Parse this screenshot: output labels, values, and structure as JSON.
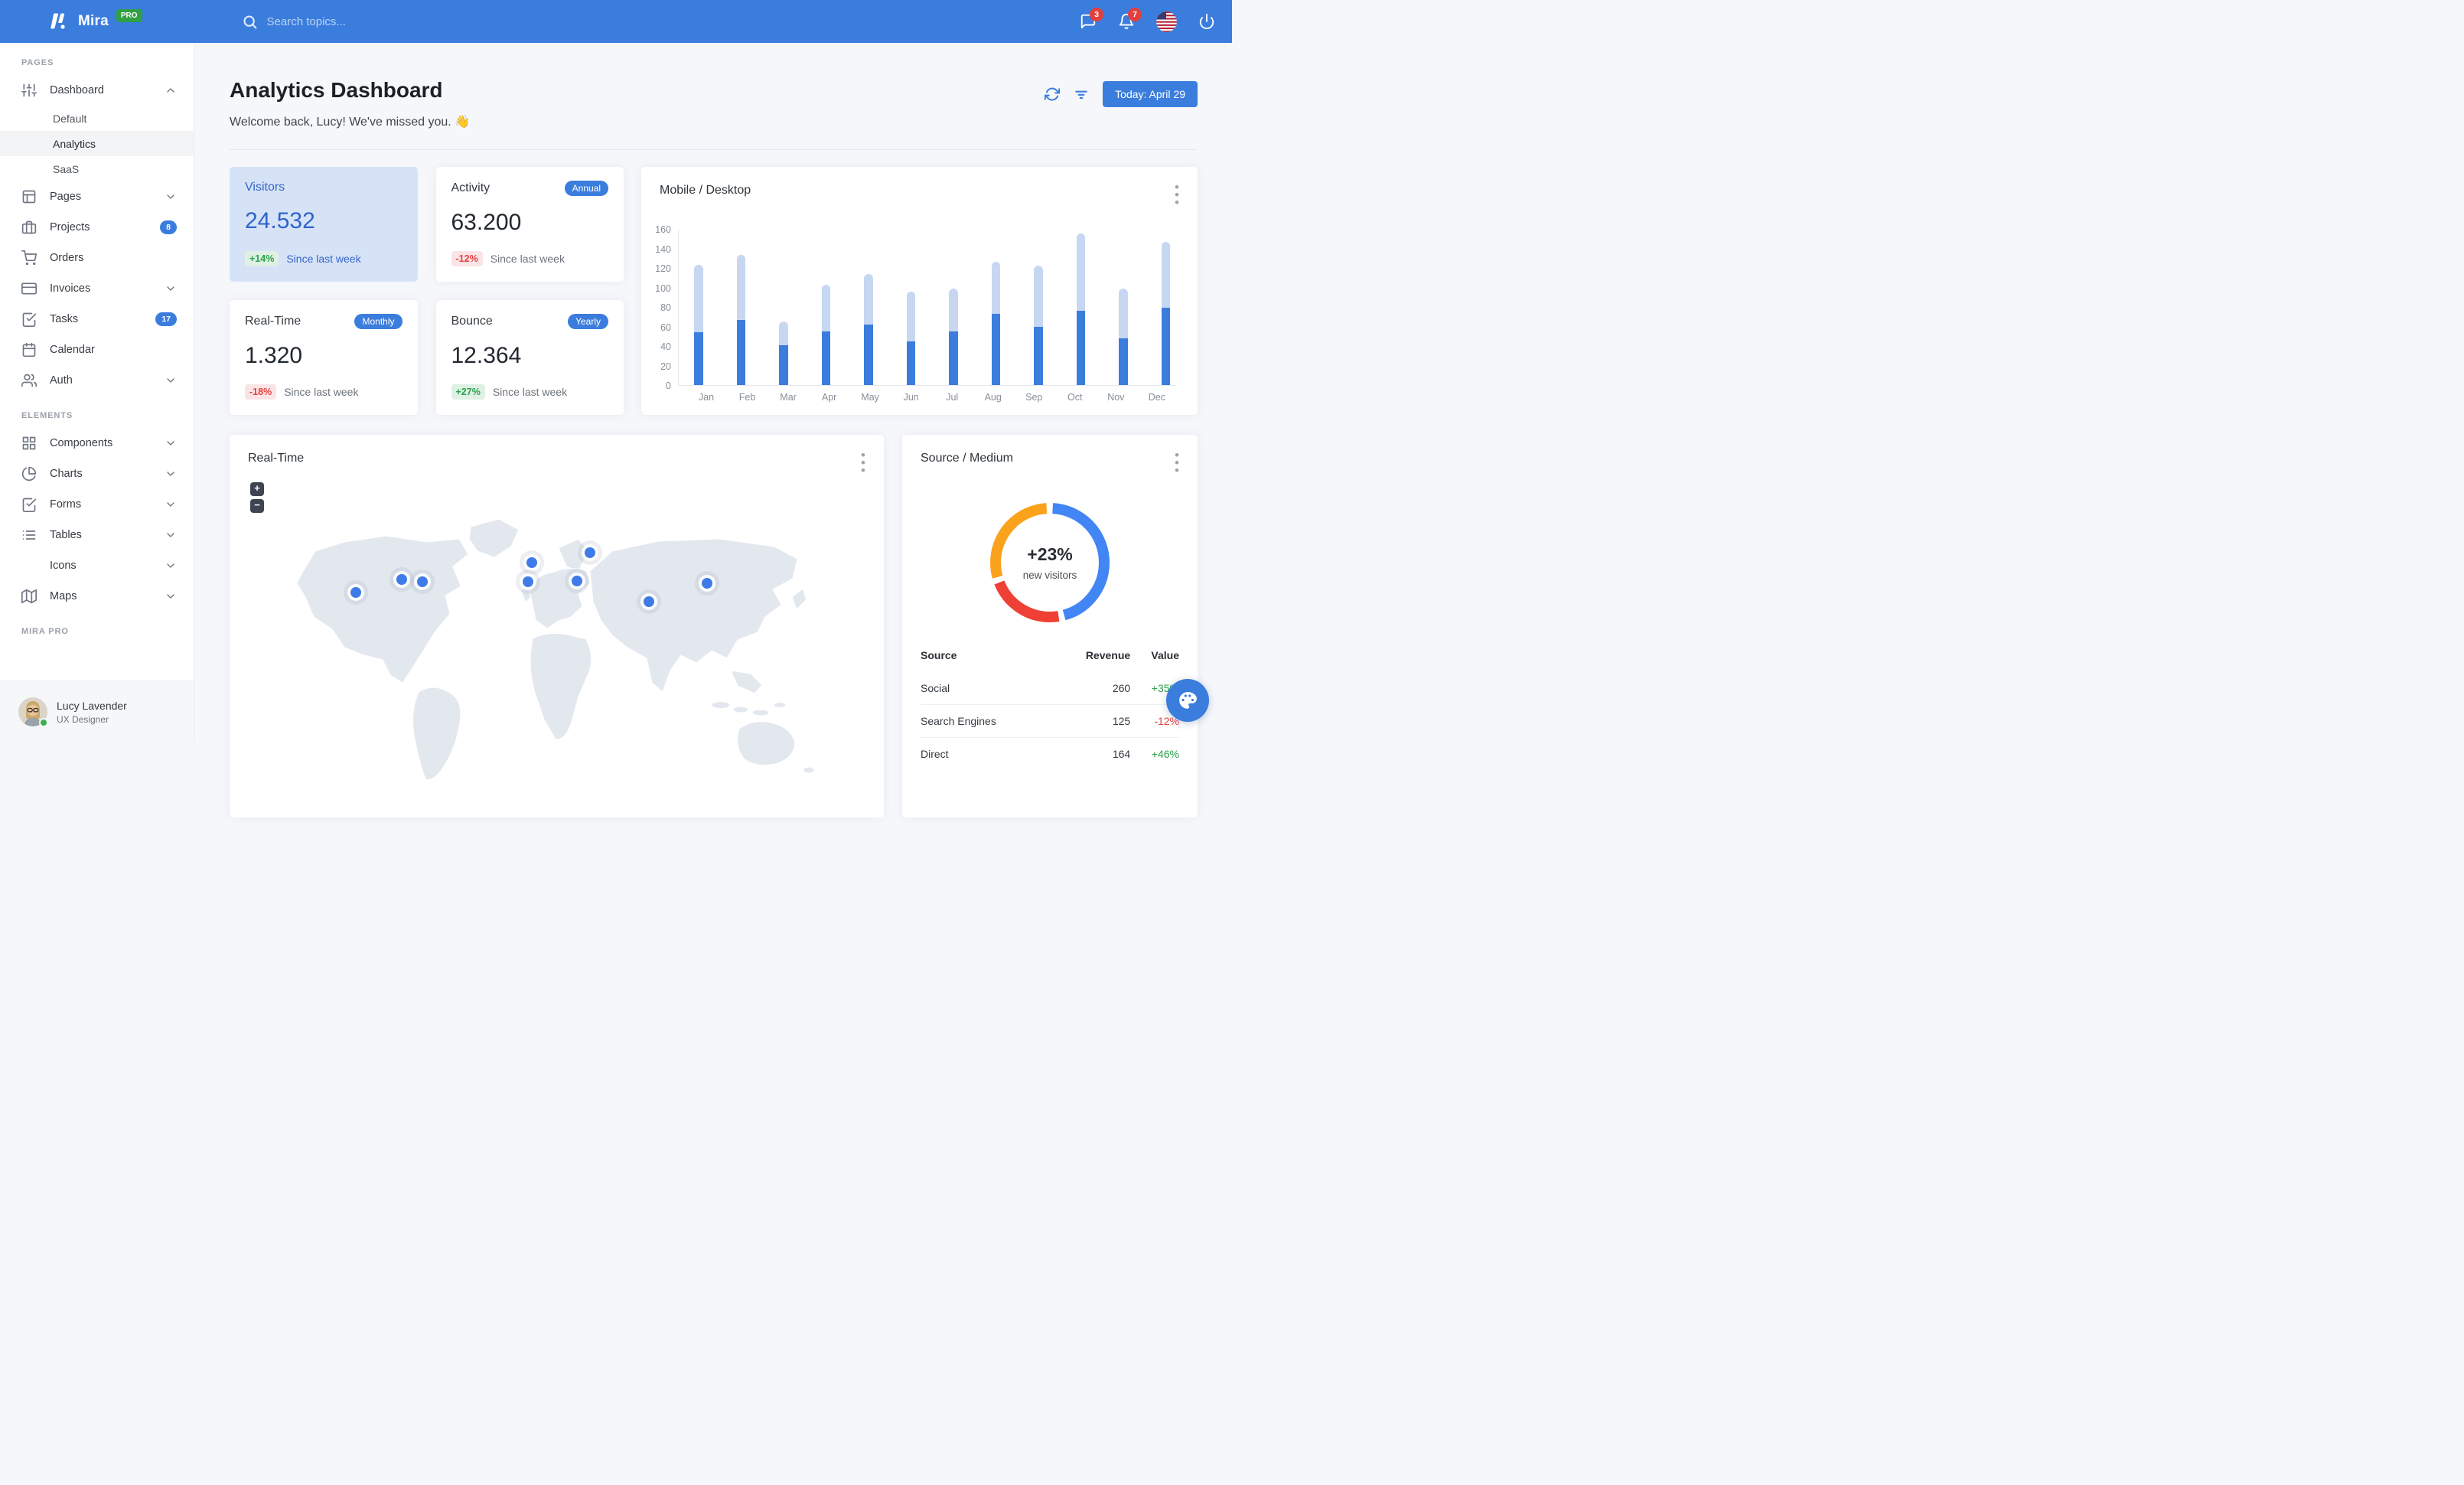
{
  "navbar": {
    "brand": "Mira",
    "brand_badge": "PRO",
    "search_placeholder": "Search topics...",
    "messages_badge": "3",
    "notifications_badge": "7"
  },
  "sidebar": {
    "sections": [
      {
        "label": "PAGES",
        "items": [
          {
            "label": "Dashboard",
            "icon": "sliders",
            "chevron": "up",
            "children": [
              {
                "label": "Default",
                "active": false
              },
              {
                "label": "Analytics",
                "active": true
              },
              {
                "label": "SaaS",
                "active": false
              }
            ]
          },
          {
            "label": "Pages",
            "icon": "layout",
            "chevron": "down"
          },
          {
            "label": "Projects",
            "icon": "briefcase",
            "badge": "8"
          },
          {
            "label": "Orders",
            "icon": "shopping-cart"
          },
          {
            "label": "Invoices",
            "icon": "credit-card",
            "chevron": "down"
          },
          {
            "label": "Tasks",
            "icon": "check-square",
            "badge": "17"
          },
          {
            "label": "Calendar",
            "icon": "calendar"
          },
          {
            "label": "Auth",
            "icon": "users",
            "chevron": "down"
          }
        ]
      },
      {
        "label": "ELEMENTS",
        "items": [
          {
            "label": "Components",
            "icon": "grid",
            "chevron": "down"
          },
          {
            "label": "Charts",
            "icon": "pie-chart",
            "chevron": "down"
          },
          {
            "label": "Forms",
            "icon": "check-square",
            "chevron": "down"
          },
          {
            "label": "Tables",
            "icon": "list",
            "chevron": "down"
          },
          {
            "label": "Icons",
            "icon": "heart",
            "chevron": "down"
          },
          {
            "label": "Maps",
            "icon": "map",
            "chevron": "down"
          }
        ]
      },
      {
        "label": "MIRA PRO",
        "items": []
      }
    ],
    "footer": {
      "name": "Lucy Lavender",
      "role": "UX Designer"
    }
  },
  "header": {
    "title": "Analytics Dashboard",
    "subtitle": "Welcome back, Lucy! We've missed you. 👋",
    "date_button": "Today: April 29"
  },
  "stats": [
    {
      "title": "Visitors",
      "badge": "",
      "value": "24.532",
      "delta": "+14%",
      "delta_type": "positive",
      "caption": "Since last week",
      "variant": "primary"
    },
    {
      "title": "Activity",
      "badge": "Annual",
      "value": "63.200",
      "delta": "-12%",
      "delta_type": "negative",
      "caption": "Since last week",
      "variant": "default"
    },
    {
      "title": "Real-Time",
      "badge": "Monthly",
      "value": "1.320",
      "delta": "-18%",
      "delta_type": "negative",
      "caption": "Since last week",
      "variant": "default"
    },
    {
      "title": "Bounce",
      "badge": "Yearly",
      "value": "12.364",
      "delta": "+27%",
      "delta_type": "positive",
      "caption": "Since last week",
      "variant": "default"
    }
  ],
  "chart_data": [
    {
      "id": "mobile-desktop",
      "type": "bar",
      "stacked": true,
      "title": "Mobile / Desktop",
      "categories": [
        "Jan",
        "Feb",
        "Mar",
        "Apr",
        "May",
        "Jun",
        "Jul",
        "Aug",
        "Sep",
        "Oct",
        "Nov",
        "Dec"
      ],
      "series": [
        {
          "name": "Mobile",
          "color": "#3B7DDD",
          "values": [
            54,
            67,
            41,
            55,
            62,
            45,
            55,
            73,
            60,
            76,
            48,
            79
          ]
        },
        {
          "name": "Desktop",
          "color": "#C7D7F2",
          "values": [
            69,
            66,
            24,
            48,
            52,
            51,
            44,
            53,
            62,
            79,
            51,
            68
          ]
        }
      ],
      "ylim": [
        0,
        160
      ],
      "ytick_step": 20,
      "grid": false,
      "legend": "none"
    },
    {
      "id": "source-medium",
      "type": "pie",
      "donut": true,
      "title": "Source / Medium",
      "labels": [
        "Social",
        "Search Engines",
        "Direct"
      ],
      "values": [
        260,
        125,
        164
      ],
      "colors": [
        "#4285F4",
        "#EF4036",
        "#FAA21B"
      ],
      "center_value": "+23%",
      "center_label": "new visitors",
      "legend": "none"
    }
  ],
  "map_card": {
    "title": "Real-Time",
    "zoom_in": "+",
    "zoom_out": "−",
    "markers": [
      {
        "name": "san-francisco",
        "x": 165,
        "y": 206
      },
      {
        "name": "chicago",
        "x": 225,
        "y": 189
      },
      {
        "name": "new-york",
        "x": 252,
        "y": 192
      },
      {
        "name": "london",
        "x": 395,
        "y": 167
      },
      {
        "name": "madrid",
        "x": 390,
        "y": 192
      },
      {
        "name": "moscow",
        "x": 471,
        "y": 154
      },
      {
        "name": "istanbul",
        "x": 454,
        "y": 191
      },
      {
        "name": "delhi",
        "x": 548,
        "y": 218
      },
      {
        "name": "beijing",
        "x": 624,
        "y": 194
      }
    ]
  },
  "source_medium": {
    "title": "Source / Medium",
    "table": {
      "headers": [
        "Source",
        "Revenue",
        "Value"
      ],
      "rows": [
        {
          "source": "Social",
          "revenue": "260",
          "value": "+35%",
          "trend": "positive"
        },
        {
          "source": "Search Engines",
          "revenue": "125",
          "value": "-12%",
          "trend": "negative"
        },
        {
          "source": "Direct",
          "revenue": "164",
          "value": "+46%",
          "trend": "positive"
        }
      ]
    }
  },
  "colors": {
    "primary": "#3B7DDD",
    "navbar": "#3B7DDD",
    "page_background": "#F5F7FB",
    "badge_red": "#E0413D",
    "badge_green": "#2FA044",
    "positive_text": "#2BA24A",
    "negative_text": "#E5413E",
    "bar_dark": "#3B7DDD",
    "bar_light": "#C7D7F2",
    "donut_blue": "#4285F4",
    "donut_red": "#EF4036",
    "donut_orange": "#FAA21B"
  }
}
